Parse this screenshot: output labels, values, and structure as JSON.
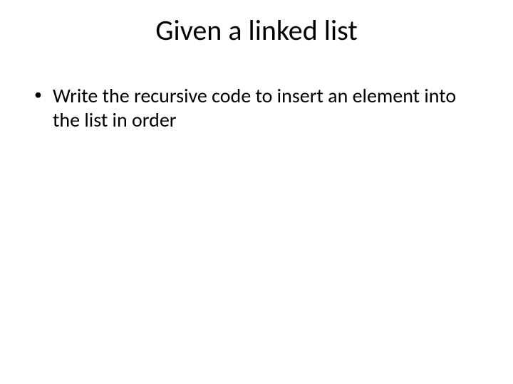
{
  "slide": {
    "title": "Given a linked list",
    "bullets": [
      {
        "marker": "•",
        "text": "Write the recursive code to insert an element into the list in order"
      }
    ]
  }
}
